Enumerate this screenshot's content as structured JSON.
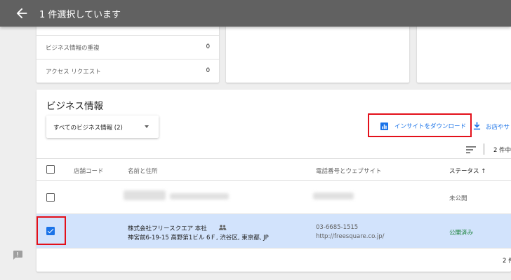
{
  "topbar": {
    "title": "1 件選択しています",
    "back_icon": "arrow-back-icon"
  },
  "stats": [
    {
      "label": "ビジネス情報の重複",
      "value": "0"
    },
    {
      "label": "アクセス リクエスト",
      "value": "0"
    }
  ],
  "section": {
    "title": "ビジネス情報",
    "filter_label": "すべてのビジネス情報 (2)",
    "download_label": "インサイトをダウンロード",
    "add_location_label": "お店やサ",
    "count_label": "2 件中"
  },
  "table": {
    "headers": {
      "code": "店舗コード",
      "name": "名前と住所",
      "phone": "電話番号とウェブサイト",
      "status": "ステータス ↑"
    },
    "rows": [
      {
        "status": "未公開",
        "checked": false
      },
      {
        "name": "株式会社フリースクエア 本社",
        "address": "神宮前6-19-15 高野第1ビル 6Ｆ, 渋谷区, 東京都, JP",
        "phone": "03-6685-1515",
        "url": "http://freesquare.co.jp/",
        "status": "公開済み",
        "checked": true
      }
    ],
    "footer_count": "2 件"
  },
  "colors": {
    "topbar": "#616161",
    "accent": "#1a73e8",
    "highlight": "#e3101a",
    "published": "#188038",
    "selected_row": "#d2e3fc"
  }
}
